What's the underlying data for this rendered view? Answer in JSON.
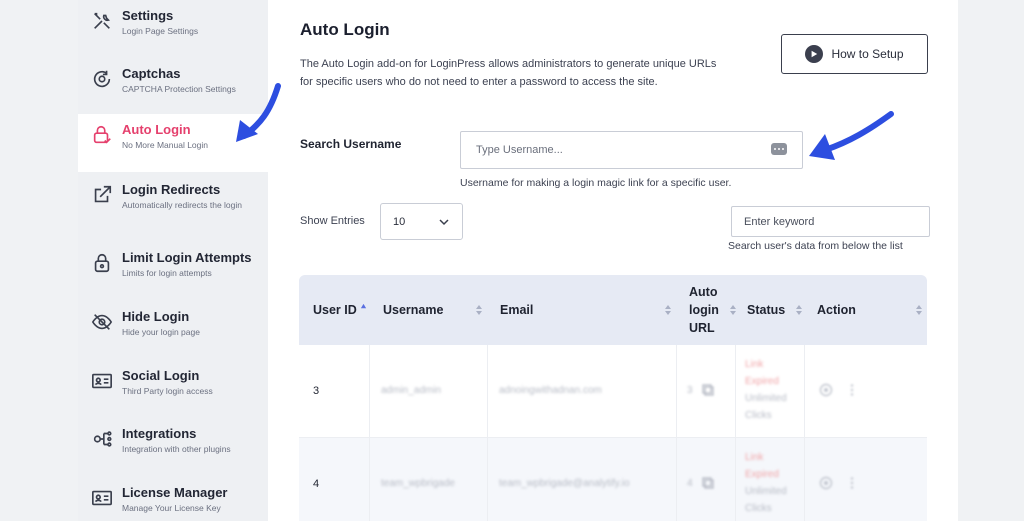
{
  "sidebar": {
    "items": [
      {
        "title": "Settings",
        "subtitle": "Login Page Settings",
        "icon": "tools-icon"
      },
      {
        "title": "Captchas",
        "subtitle": "CAPTCHA Protection Settings",
        "icon": "captcha-icon"
      },
      {
        "title": "Auto Login",
        "subtitle": "No More Manual Login",
        "icon": "lock-icon",
        "active": true
      },
      {
        "title": "Login Redirects",
        "subtitle": "Automatically redirects the login",
        "icon": "redirect-icon"
      },
      {
        "title": "Limit Login Attempts",
        "subtitle": "Limits for login attempts",
        "icon": "padlock-icon"
      },
      {
        "title": "Hide Login",
        "subtitle": "Hide your login page",
        "icon": "eye-slash-icon"
      },
      {
        "title": "Social Login",
        "subtitle": "Third Party login access",
        "icon": "id-card-icon"
      },
      {
        "title": "Integrations",
        "subtitle": "Integration with other plugins",
        "icon": "integrations-icon"
      },
      {
        "title": "License Manager",
        "subtitle": "Manage Your License Key",
        "icon": "license-icon"
      }
    ]
  },
  "main": {
    "title": "Auto Login",
    "description": "The Auto Login add-on for LoginPress allows administrators to generate unique URLs for specific users who do not need to enter a password to access the site.",
    "setup_button": "How to Setup",
    "search_label": "Search Username",
    "search_placeholder": "Type Username...",
    "search_help": "Username for making a login magic link for a specific user.",
    "show_entries_label": "Show Entries",
    "entries_value": "10",
    "keyword_placeholder": "Enter keyword",
    "keyword_help": "Search user's data from below the list"
  },
  "table": {
    "headers": {
      "user_id": "User ID",
      "username": "Username",
      "email": "Email",
      "auto_login_url_1": "Auto",
      "auto_login_url_2": "login",
      "auto_login_url_3": "URL",
      "status": "Status",
      "action": "Action"
    },
    "rows": [
      {
        "id": "3",
        "username": "admin_admin",
        "email": "adnoingwithadnan.com",
        "link_num": "3",
        "status_1": "Link",
        "status_2": "Expired",
        "status_3": "Unlimited",
        "status_4": "Clicks"
      },
      {
        "id": "4",
        "username": "team_wpbrigade",
        "email": "team_wpbrigade@analytify.io",
        "link_num": "4",
        "status_1": "Link",
        "status_2": "Expired",
        "status_3": "Unlimited",
        "status_4": "Clicks"
      }
    ]
  },
  "colors": {
    "accent_pink": "#e5406d",
    "arrow_blue": "#2d4ee0",
    "table_header_bg": "#e6eaf4"
  }
}
